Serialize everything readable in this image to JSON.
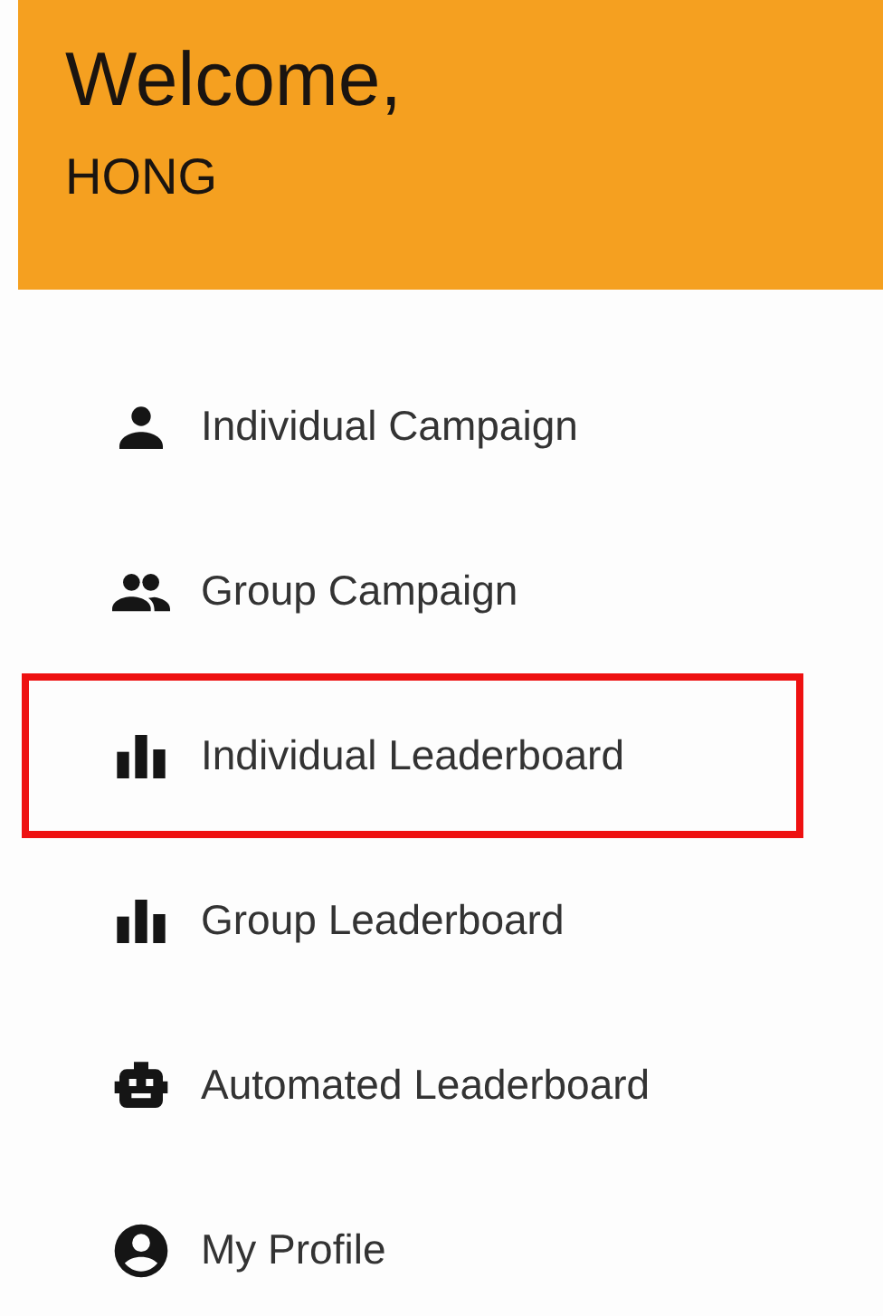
{
  "header": {
    "greeting": "Welcome,",
    "user_name": "HONG"
  },
  "menu": [
    {
      "label": "Individual Campaign",
      "kind": "person",
      "selected": false
    },
    {
      "label": "Group Campaign",
      "kind": "group",
      "selected": false
    },
    {
      "label": "Individual Leaderboard",
      "kind": "chart",
      "selected": true
    },
    {
      "label": "Group Leaderboard",
      "kind": "chart",
      "selected": false
    },
    {
      "label": "Automated Leaderboard",
      "kind": "robot",
      "selected": false
    },
    {
      "label": "My Profile",
      "kind": "account",
      "selected": false
    }
  ]
}
